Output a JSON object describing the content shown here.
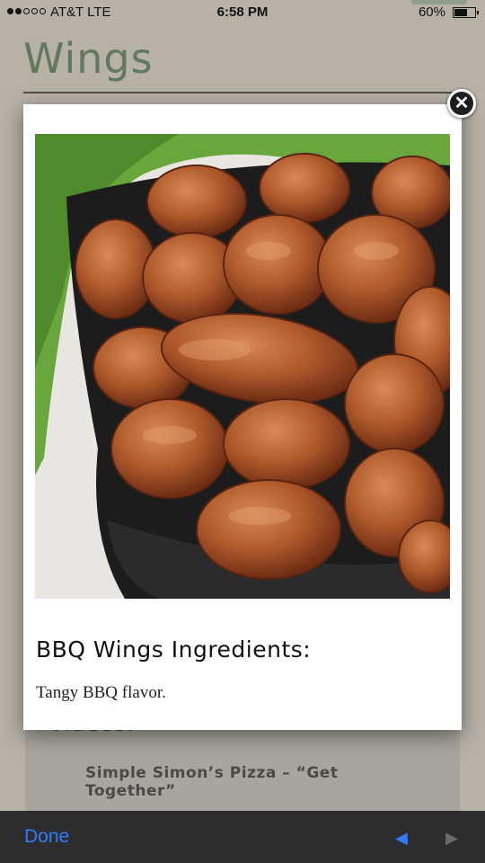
{
  "status_bar": {
    "carrier": "AT&T   LTE",
    "time": "6:58 PM",
    "battery": "60%"
  },
  "page": {
    "title": "Wings",
    "videos_heading": "Videos:",
    "video_link": "Simple Simon’s Pizza – “Get Together”"
  },
  "modal": {
    "image_icon": "chicken-wings-photo",
    "heading": "BBQ Wings Ingredients:",
    "description": "Tangy BBQ flavor.",
    "close_icon": "close-icon"
  },
  "toolbar": {
    "done_label": "Done",
    "prev_icon": "back-arrow-icon",
    "next_icon": "forward-arrow-icon"
  },
  "colors": {
    "accent": "#2f7cf6",
    "title_green": "#5f7a5e",
    "toolbar_bg": "#2d2d2f"
  }
}
